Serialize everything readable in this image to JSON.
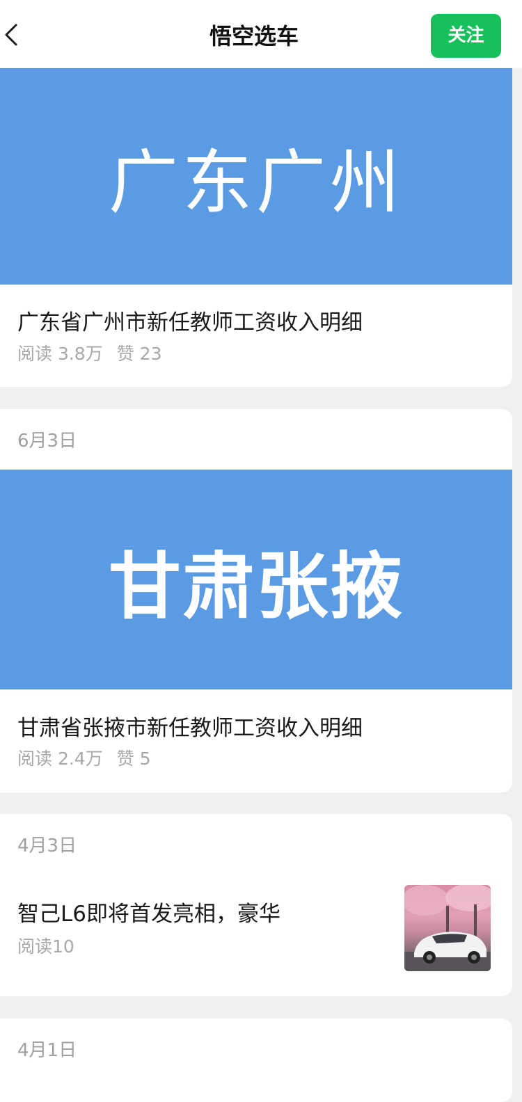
{
  "header": {
    "title": "悟空选车",
    "follow_label": "关注"
  },
  "articles": [
    {
      "banner_text": "广东广州",
      "title": "广东省广州市新任教师工资收入明细",
      "read_label": "阅读 3.8万",
      "like_label": "赞 23"
    },
    {
      "date": "6月3日",
      "banner_text": "甘肃张掖",
      "title": "甘肃省张掖市新任教师工资收入明细",
      "read_label": "阅读 2.4万",
      "like_label": "赞 5"
    },
    {
      "date": "4月3日",
      "title": "智己L6即将首发亮相，豪华",
      "read_label": "阅读10"
    },
    {
      "date": "4月1日"
    }
  ],
  "colors": {
    "accent": "#16c05a",
    "banner": "#5a9be3",
    "background": "#efefef"
  }
}
